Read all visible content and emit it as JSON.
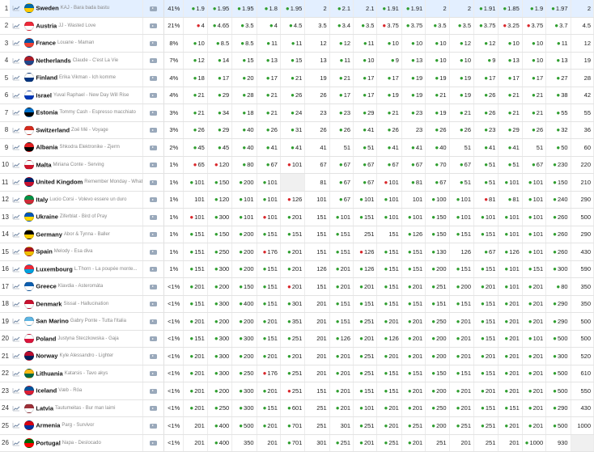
{
  "rows": [
    {
      "rank": "1",
      "country": "Sweden",
      "song": "KAJ - Bara bada bastu",
      "pct": "41%",
      "flag": [
        "#006aa7",
        "#fecc00"
      ],
      "odds": [
        "g:1.9",
        "g:1.95",
        "g:1.95",
        "g:1.8",
        "g:1.95",
        "2",
        "g:2.1",
        "2.1",
        "g:1.91",
        "g:1.91",
        "2",
        "2",
        "g:1.91",
        "g:1.85",
        "g:1.9",
        "g:1.97",
        "2"
      ]
    },
    {
      "rank": "2",
      "country": "Austria",
      "song": "JJ - Wasted Love",
      "pct": "21%",
      "flag": [
        "#ed2939",
        "#ffffff"
      ],
      "odds": [
        "r:4",
        "g:4.65",
        "g:3.5",
        "g:4",
        "g:4.5",
        "3.5",
        "g:3.4",
        "g:3.5",
        "r:3.75",
        "g:3.75",
        "g:3.5",
        "g:3.5",
        "g:3.75",
        "r:3.25",
        "r:3.75",
        "g:3.7",
        "4.5"
      ]
    },
    {
      "rank": "3",
      "country": "France",
      "song": "Louane - Maman",
      "pct": "8%",
      "flag": [
        "#0055a4",
        "#ef4135"
      ],
      "odds": [
        "g:10",
        "g:8.5",
        "g:8.5",
        "g:11",
        "g:11",
        "12",
        "g:12",
        "g:11",
        "g:10",
        "g:10",
        "g:10",
        "g:12",
        "g:12",
        "g:10",
        "g:10",
        "g:11",
        "12"
      ]
    },
    {
      "rank": "4",
      "country": "Netherlands",
      "song": "Claude - C'est La Vie",
      "pct": "7%",
      "flag": [
        "#ae1c28",
        "#21468b"
      ],
      "odds": [
        "g:12",
        "g:14",
        "g:15",
        "g:13",
        "g:15",
        "13",
        "g:11",
        "g:10",
        "g:9",
        "g:13",
        "g:10",
        "g:10",
        "g:9",
        "g:13",
        "g:10",
        "g:13",
        "19"
      ]
    },
    {
      "rank": "5",
      "country": "Finland",
      "song": "Erika Vikman - Ich komme",
      "pct": "4%",
      "flag": [
        "#ffffff",
        "#003580"
      ],
      "odds": [
        "g:18",
        "g:17",
        "g:20",
        "g:17",
        "g:21",
        "19",
        "g:21",
        "g:17",
        "g:17",
        "g:19",
        "g:19",
        "g:19",
        "g:17",
        "g:17",
        "g:17",
        "g:27",
        "28"
      ]
    },
    {
      "rank": "6",
      "country": "Israel",
      "song": "Yuval Raphael - New Day Will Rise",
      "pct": "4%",
      "flag": [
        "#ffffff",
        "#0038b8"
      ],
      "odds": [
        "g:21",
        "g:29",
        "g:28",
        "g:21",
        "g:26",
        "26",
        "g:17",
        "g:17",
        "g:19",
        "g:19",
        "g:21",
        "g:19",
        "g:26",
        "g:21",
        "g:21",
        "g:38",
        "42"
      ]
    },
    {
      "rank": "7",
      "country": "Estonia",
      "song": "Tommy Cash - Espresso macchiato",
      "pct": "3%",
      "flag": [
        "#0072ce",
        "#000000"
      ],
      "odds": [
        "g:21",
        "g:34",
        "g:18",
        "g:21",
        "g:24",
        "23",
        "g:23",
        "g:29",
        "g:21",
        "g:23",
        "g:19",
        "g:21",
        "g:26",
        "g:21",
        "g:21",
        "g:55",
        "55"
      ]
    },
    {
      "rank": "8",
      "country": "Switzerland",
      "song": "Zoë Më - Voyage",
      "pct": "3%",
      "flag": [
        "#d52b1e",
        "#ffffff"
      ],
      "odds": [
        "g:26",
        "g:29",
        "g:40",
        "g:26",
        "g:31",
        "26",
        "g:26",
        "g:41",
        "g:26",
        "23",
        "g:26",
        "g:26",
        "g:23",
        "g:29",
        "g:26",
        "g:32",
        "36"
      ]
    },
    {
      "rank": "9",
      "country": "Albania",
      "song": "Shkodra Elektronike - Zjerm",
      "pct": "2%",
      "flag": [
        "#e41e20",
        "#000000"
      ],
      "odds": [
        "g:45",
        "g:45",
        "g:40",
        "g:41",
        "g:41",
        "41",
        "51",
        "g:51",
        "g:41",
        "g:41",
        "g:40",
        "51",
        "g:41",
        "g:41",
        "51",
        "g:50",
        "60"
      ]
    },
    {
      "rank": "10",
      "country": "Malta",
      "song": "Miriana Conte - Serving",
      "pct": "1%",
      "flag": [
        "#ffffff",
        "#cf142b"
      ],
      "odds": [
        "r:65",
        "r:120",
        "g:80",
        "g:67",
        "r:101",
        "67",
        "g:67",
        "g:67",
        "g:67",
        "g:67",
        "g:70",
        "g:67",
        "g:51",
        "g:51",
        "g:67",
        "g:230",
        "220"
      ]
    },
    {
      "rank": "11",
      "country": "United Kingdom",
      "song": "Remember Monday - What...",
      "pct": "1%",
      "flag": [
        "#012169",
        "#c8102e"
      ],
      "odds": [
        "g:101",
        "g:150",
        "g:200",
        "g:101",
        "",
        "81",
        "g:67",
        "g:67",
        "r:101",
        "g:81",
        "g:67",
        "g:51",
        "g:51",
        "g:101",
        "g:101",
        "g:150",
        "210"
      ]
    },
    {
      "rank": "12",
      "country": "Italy",
      "song": "Lucio Corsi - Volevo essere un duro",
      "pct": "1%",
      "flag": [
        "#009246",
        "#ce2b37"
      ],
      "odds": [
        "101",
        "g:120",
        "g:101",
        "g:101",
        "r:126",
        "101",
        "g:67",
        "g:101",
        "g:101",
        "101",
        "g:100",
        "g:101",
        "r:81",
        "g:81",
        "g:101",
        "g:240",
        "290"
      ]
    },
    {
      "rank": "13",
      "country": "Ukraine",
      "song": "Ziferblat - Bird of Pray",
      "pct": "1%",
      "flag": [
        "#0057b7",
        "#ffd700"
      ],
      "odds": [
        "r:101",
        "g:300",
        "g:101",
        "r:101",
        "g:201",
        "151",
        "g:101",
        "g:151",
        "g:101",
        "g:101",
        "g:150",
        "g:101",
        "g:101",
        "g:101",
        "g:101",
        "g:260",
        "500"
      ]
    },
    {
      "rank": "14",
      "country": "Germany",
      "song": "Abor & Tynna - Baller",
      "pct": "1%",
      "flag": [
        "#000000",
        "#ffce00"
      ],
      "odds": [
        "g:151",
        "g:150",
        "g:200",
        "g:151",
        "g:151",
        "151",
        "g:151",
        "251",
        "151",
        "g:126",
        "g:150",
        "g:151",
        "g:151",
        "g:101",
        "g:101",
        "g:260",
        "290"
      ]
    },
    {
      "rank": "15",
      "country": "Spain",
      "song": "Melody - Esa diva",
      "pct": "1%",
      "flag": [
        "#aa151b",
        "#f1bf00"
      ],
      "odds": [
        "g:151",
        "g:250",
        "g:200",
        "r:176",
        "g:201",
        "151",
        "g:151",
        "r:126",
        "g:151",
        "g:151",
        "g:130",
        "126",
        "g:67",
        "g:126",
        "g:101",
        "g:260",
        "430"
      ]
    },
    {
      "rank": "16",
      "country": "Luxembourg",
      "song": "L.Thorn - La poupée monte...",
      "pct": "1%",
      "flag": [
        "#ed2939",
        "#00a1de"
      ],
      "odds": [
        "g:151",
        "g:300",
        "g:200",
        "g:151",
        "g:201",
        "126",
        "g:201",
        "g:126",
        "g:151",
        "g:151",
        "g:200",
        "g:151",
        "g:151",
        "g:101",
        "g:151",
        "g:300",
        "590"
      ]
    },
    {
      "rank": "17",
      "country": "Greece",
      "song": "Klavdia - Asteromáta",
      "pct": "<1%",
      "flag": [
        "#0d5eaf",
        "#ffffff"
      ],
      "odds": [
        "g:201",
        "g:200",
        "g:150",
        "g:151",
        "r:201",
        "151",
        "g:201",
        "g:201",
        "g:151",
        "g:201",
        "g:251",
        "g:200",
        "g:201",
        "g:101",
        "g:201",
        "g:80",
        "350"
      ]
    },
    {
      "rank": "18",
      "country": "Denmark",
      "song": "Sissal - Hallucination",
      "pct": "<1%",
      "flag": [
        "#c8102e",
        "#ffffff"
      ],
      "odds": [
        "g:151",
        "g:300",
        "g:400",
        "g:151",
        "g:301",
        "201",
        "g:151",
        "g:151",
        "g:151",
        "g:151",
        "g:151",
        "g:151",
        "g:151",
        "g:201",
        "g:201",
        "g:290",
        "350"
      ]
    },
    {
      "rank": "19",
      "country": "San Marino",
      "song": "Gabry Ponte - Tutta l'Italia",
      "pct": "<1%",
      "flag": [
        "#5eb6e4",
        "#ffffff"
      ],
      "odds": [
        "g:201",
        "g:200",
        "g:200",
        "g:201",
        "g:351",
        "201",
        "g:151",
        "g:251",
        "g:201",
        "g:201",
        "g:250",
        "g:201",
        "g:151",
        "g:201",
        "g:201",
        "g:290",
        "500"
      ]
    },
    {
      "rank": "20",
      "country": "Poland",
      "song": "Justyna Steczkowska - Gaja",
      "pct": "<1%",
      "flag": [
        "#ffffff",
        "#dc143c"
      ],
      "odds": [
        "g:151",
        "g:300",
        "g:300",
        "g:151",
        "g:251",
        "201",
        "g:126",
        "g:201",
        "g:126",
        "g:201",
        "g:200",
        "g:201",
        "g:151",
        "g:201",
        "g:101",
        "g:500",
        "500"
      ]
    },
    {
      "rank": "21",
      "country": "Norway",
      "song": "Kyle Alessandro - Lighter",
      "pct": "<1%",
      "flag": [
        "#ba0c2f",
        "#00205b"
      ],
      "odds": [
        "g:201",
        "g:300",
        "g:200",
        "g:201",
        "g:201",
        "201",
        "g:201",
        "g:251",
        "g:201",
        "g:201",
        "g:200",
        "g:201",
        "g:201",
        "g:201",
        "g:201",
        "g:300",
        "520"
      ]
    },
    {
      "rank": "22",
      "country": "Lithuania",
      "song": "Katarsis - Tavo akys",
      "pct": "<1%",
      "flag": [
        "#fdb913",
        "#006a44"
      ],
      "odds": [
        "g:201",
        "g:300",
        "g:250",
        "r:176",
        "g:251",
        "201",
        "g:201",
        "g:251",
        "g:151",
        "g:151",
        "g:150",
        "g:151",
        "g:151",
        "g:201",
        "g:201",
        "g:500",
        "610"
      ]
    },
    {
      "rank": "23",
      "country": "Iceland",
      "song": "Væb - Róa",
      "pct": "<1%",
      "flag": [
        "#02529c",
        "#dc1e35"
      ],
      "odds": [
        "g:201",
        "g:200",
        "g:300",
        "g:201",
        "r:251",
        "151",
        "g:201",
        "g:151",
        "g:151",
        "g:201",
        "g:200",
        "g:201",
        "g:201",
        "g:201",
        "g:201",
        "g:500",
        "550"
      ]
    },
    {
      "rank": "24",
      "country": "Latvia",
      "song": "Tautumeitas - Bur man laimi",
      "pct": "<1%",
      "flag": [
        "#9e3039",
        "#ffffff"
      ],
      "odds": [
        "g:201",
        "g:250",
        "g:300",
        "g:151",
        "g:601",
        "251",
        "g:201",
        "g:101",
        "g:201",
        "g:201",
        "g:250",
        "g:201",
        "g:151",
        "g:151",
        "g:201",
        "g:290",
        "430"
      ]
    },
    {
      "rank": "25",
      "country": "Armenia",
      "song": "Parg - Survivor",
      "pct": "<1%",
      "flag": [
        "#d90012",
        "#0033a0"
      ],
      "odds": [
        "201",
        "g:400",
        "g:500",
        "g:201",
        "g:701",
        "251",
        "301",
        "g:251",
        "g:201",
        "g:251",
        "g:200",
        "g:251",
        "g:251",
        "g:201",
        "g:201",
        "g:500",
        "1000"
      ]
    },
    {
      "rank": "26",
      "country": "Portugal",
      "song": "Napa - Deslocado",
      "pct": "<1%",
      "flag": [
        "#006600",
        "#ff0000"
      ],
      "odds": [
        "201",
        "g:400",
        "350",
        "201",
        "g:701",
        "301",
        "g:251",
        "g:201",
        "g:251",
        "g:201",
        "251",
        "201",
        "251",
        "201",
        "g:1000",
        "930",
        ""
      ]
    }
  ]
}
